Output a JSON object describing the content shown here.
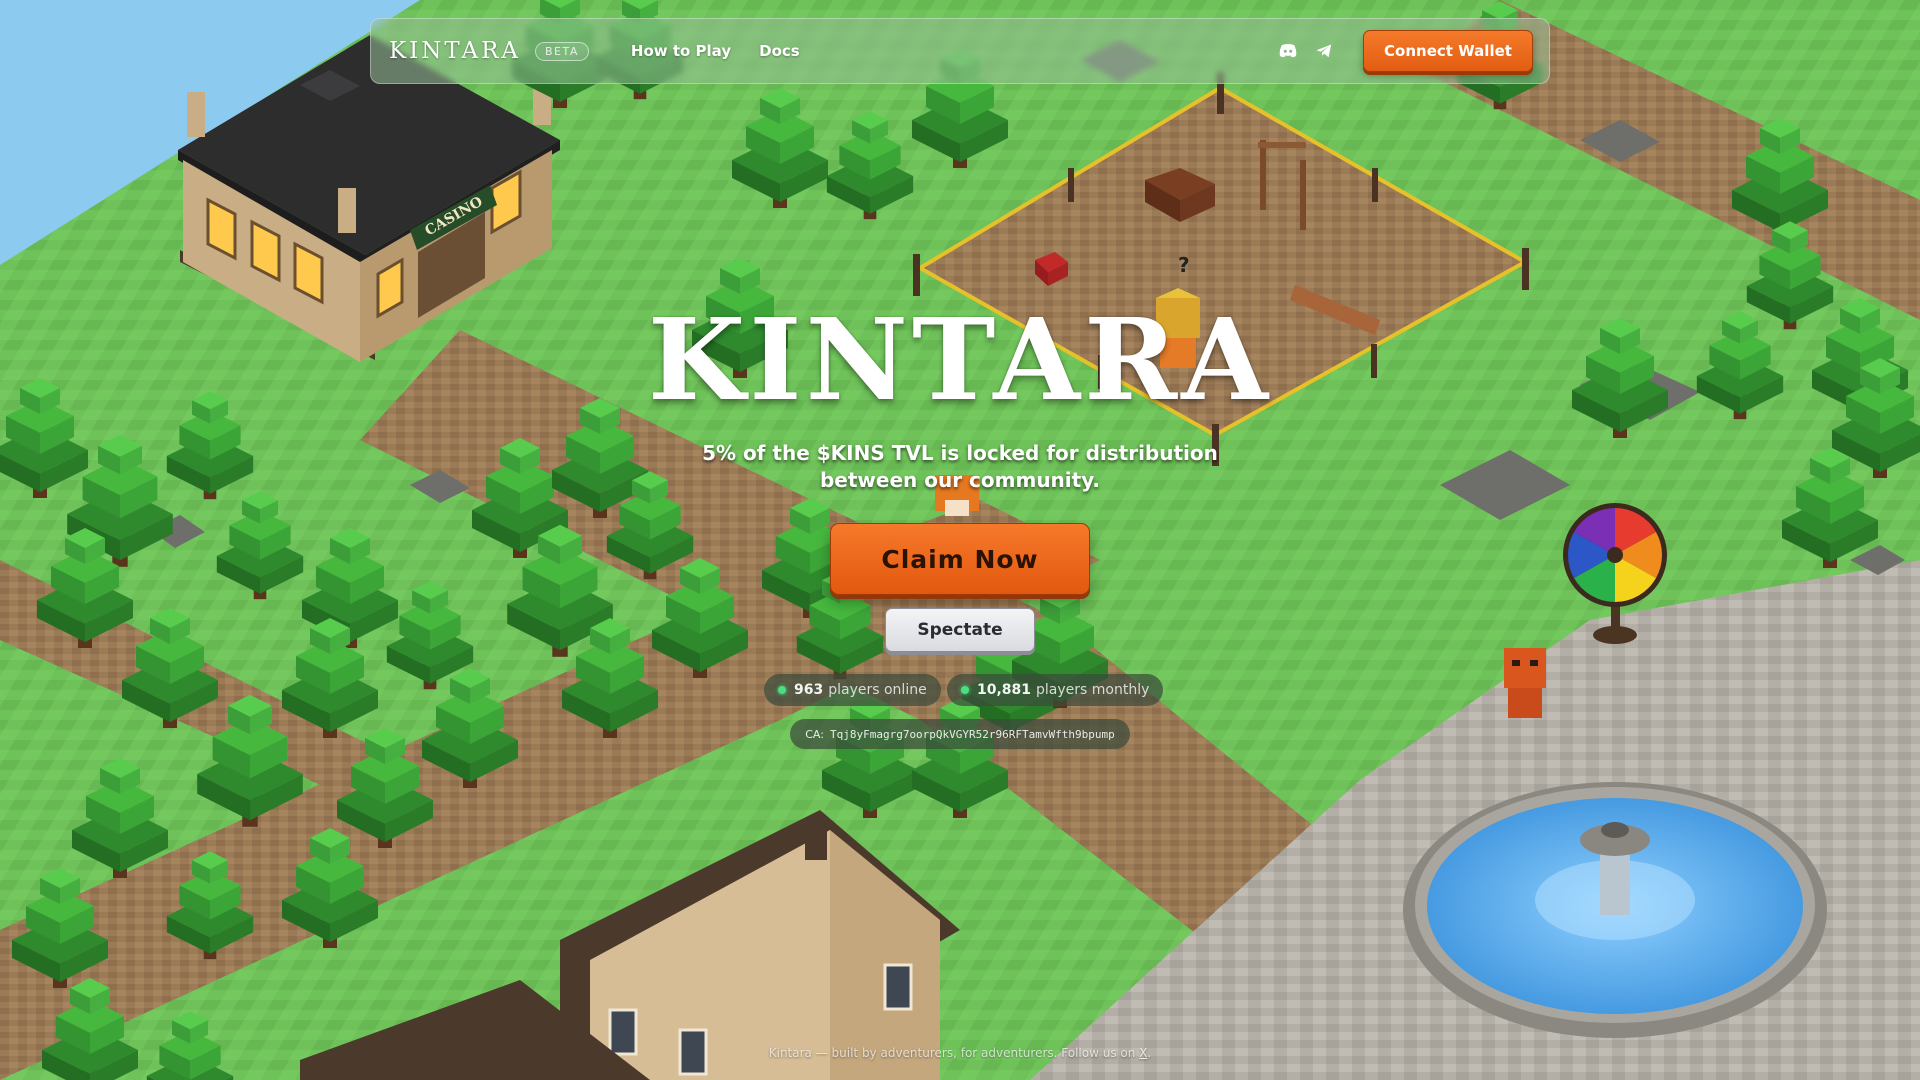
{
  "navbar": {
    "brand": "KINTARA",
    "badge": "BETA",
    "links": [
      "How to Play",
      "Docs"
    ],
    "social": [
      "discord-icon",
      "telegram-icon"
    ],
    "connect_wallet": "Connect Wallet"
  },
  "hero": {
    "title": "KINTARA",
    "subtitle": "5% of the $KINS TVL is locked for distribution between our community.",
    "claim_button": "Claim Now",
    "spectate_button": "Spectate"
  },
  "stats": {
    "online_count": "963",
    "online_label": "players online",
    "monthly_count": "10,881",
    "monthly_label": "players monthly"
  },
  "contract": {
    "label": "CA:",
    "address": "Tqj8yFmagrg7oorpQkVGYR52r96RFTamvWfth9bpump"
  },
  "scene": {
    "casino_sign": "CASINO",
    "npc_marker": "?"
  },
  "footer": {
    "text": "Kintara — built by adventurers, for adventurers. Follow us on",
    "link": "X",
    "end": "."
  },
  "colors": {
    "grass": "#6fc25a",
    "accent_orange": "#f06a1e",
    "path_dirt": "#9c7a55",
    "water": "#4aa3e6",
    "stone": "#b9b6ae"
  }
}
